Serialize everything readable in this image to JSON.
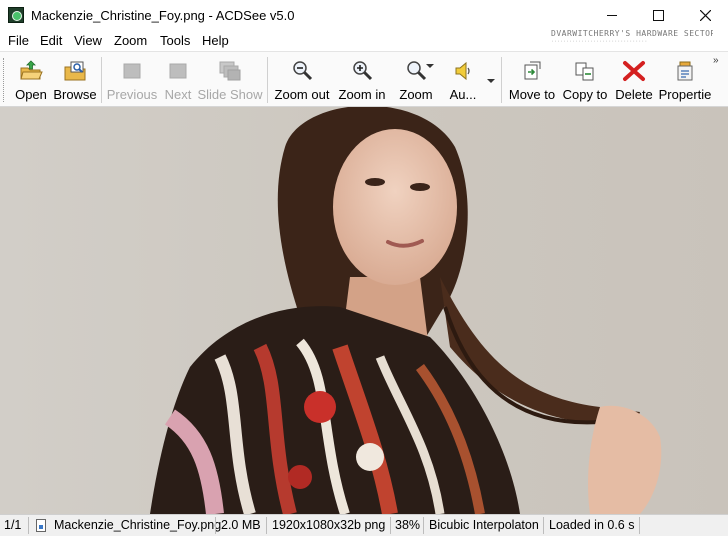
{
  "window": {
    "title": "Mackenzie_Christine_Foy.png - ACDSee v5.0",
    "watermark": "DVARWITCHERRY'S HARDWARE SECTOR",
    "watermark_sub": "································"
  },
  "menu": [
    "File",
    "Edit",
    "View",
    "Zoom",
    "Tools",
    "Help"
  ],
  "toolbar": {
    "open": "Open",
    "browse": "Browse",
    "previous": "Previous",
    "next": "Next",
    "slideshow": "Slide Show",
    "zoom_out": "Zoom out",
    "zoom_in": "Zoom in",
    "zoom": "Zoom",
    "audio": "Au...",
    "move_to": "Move to",
    "copy_to": "Copy to",
    "delete": "Delete",
    "properties": "Propertie",
    "more": "»"
  },
  "status": {
    "index": "1/1",
    "filename": "Mackenzie_Christine_Foy.png",
    "size": "2.0 MB",
    "dimensions": "1920x1080x32b png",
    "zoom": "38%",
    "interpolation": "Bicubic Interpolaton",
    "load_time": "Loaded in 0.6 s"
  },
  "colors": {
    "background": "#cdc8c0",
    "delete_red": "#d42020"
  }
}
